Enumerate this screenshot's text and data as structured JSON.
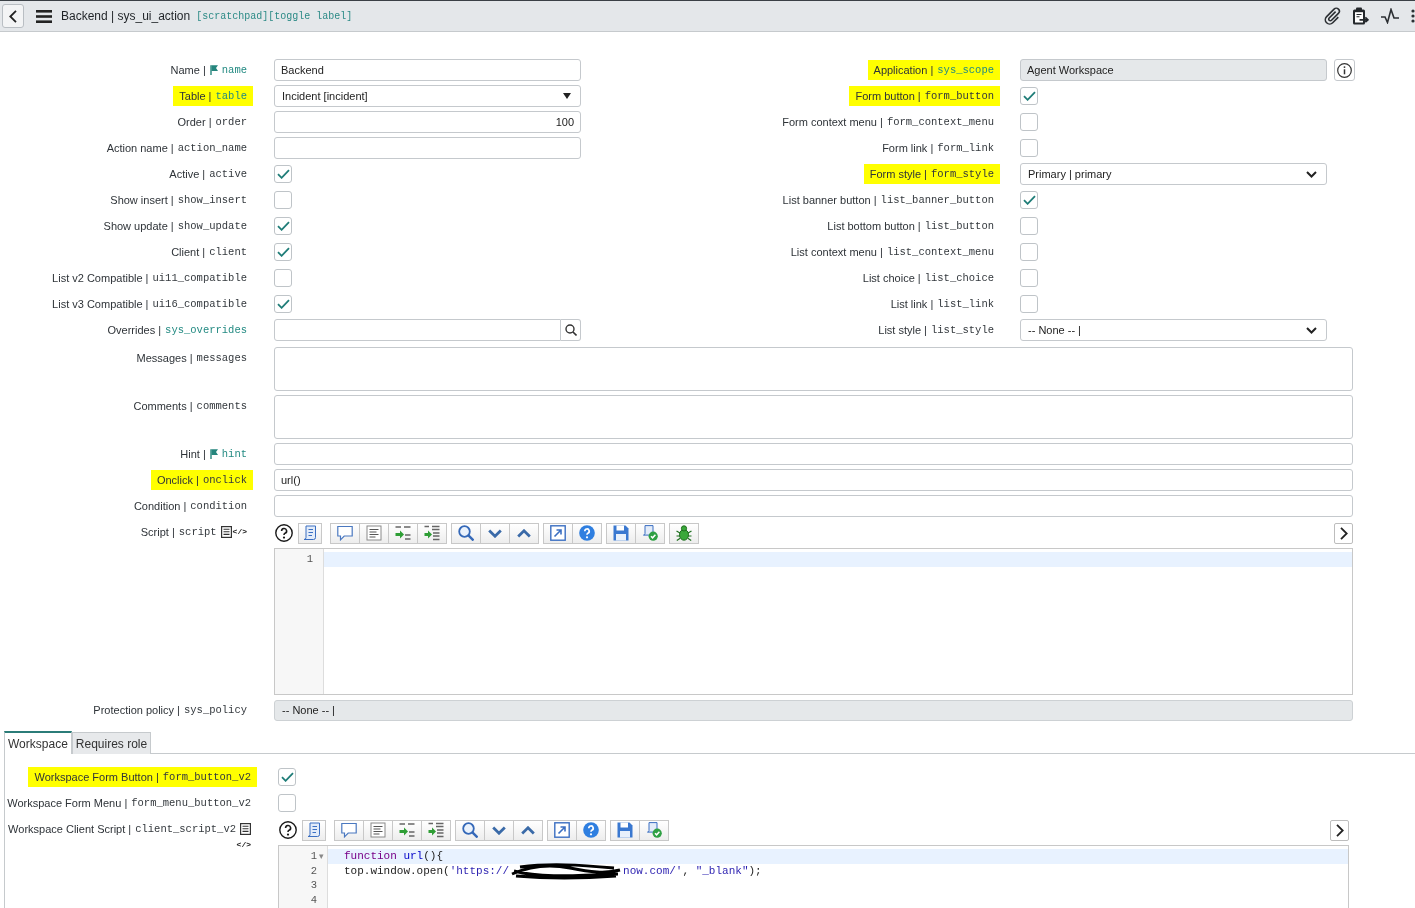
{
  "header": {
    "title": "Backend | sys_ui_action",
    "links": [
      "[scratchpad]",
      "[toggle label]"
    ]
  },
  "left_fields": [
    {
      "label": "Name |",
      "field": "name",
      "flag": true,
      "emphasized": true,
      "highlighted": false,
      "kind": "text",
      "value": "Backend"
    },
    {
      "label": "Table |",
      "field": "table",
      "flag": false,
      "emphasized": true,
      "highlighted": true,
      "kind": "choice",
      "value": "Incident [incident]"
    },
    {
      "label": "Order |",
      "field": "order",
      "flag": false,
      "emphasized": false,
      "highlighted": false,
      "kind": "number",
      "value": "100"
    },
    {
      "label": "Action name |",
      "field": "action_name",
      "flag": false,
      "emphasized": false,
      "highlighted": false,
      "kind": "text"
    },
    {
      "label": "Active |",
      "field": "active",
      "flag": false,
      "emphasized": false,
      "highlighted": false,
      "kind": "checkbox",
      "checked": true
    },
    {
      "label": "Show insert |",
      "field": "show_insert",
      "flag": false,
      "emphasized": false,
      "highlighted": false,
      "kind": "checkbox",
      "checked": false
    },
    {
      "label": "Show update |",
      "field": "show_update",
      "flag": false,
      "emphasized": false,
      "highlighted": false,
      "kind": "checkbox",
      "checked": true
    },
    {
      "label": "Client |",
      "field": "client",
      "flag": false,
      "emphasized": false,
      "highlighted": false,
      "kind": "checkbox",
      "checked": true
    },
    {
      "label": "List v2 Compatible |",
      "field": "ui11_compatible",
      "flag": false,
      "emphasized": false,
      "highlighted": false,
      "kind": "checkbox",
      "checked": false
    },
    {
      "label": "List v3 Compatible |",
      "field": "ui16_compatible",
      "flag": false,
      "emphasized": false,
      "highlighted": false,
      "kind": "checkbox",
      "checked": true
    },
    {
      "label": "Overrides |",
      "field": "sys_overrides",
      "flag": false,
      "emphasized": true,
      "highlighted": false,
      "kind": "reference"
    }
  ],
  "right_fields": [
    {
      "label": "Application |",
      "field": "sys_scope",
      "flag": false,
      "emphasized": true,
      "highlighted": true,
      "kind": "reference-readonly",
      "value": "Agent Workspace"
    },
    {
      "label": "Form button |",
      "field": "form_button",
      "flag": false,
      "emphasized": false,
      "highlighted": true,
      "kind": "checkbox",
      "checked": true
    },
    {
      "label": "Form context menu |",
      "field": "form_context_menu",
      "flag": false,
      "emphasized": false,
      "highlighted": false,
      "kind": "checkbox",
      "checked": false
    },
    {
      "label": "Form link |",
      "field": "form_link",
      "flag": false,
      "emphasized": false,
      "highlighted": false,
      "kind": "checkbox",
      "checked": false
    },
    {
      "label": "Form style |",
      "field": "form_style",
      "flag": false,
      "emphasized": false,
      "highlighted": true,
      "kind": "select",
      "value": "Primary | primary"
    },
    {
      "label": "List banner button |",
      "field": "list_banner_button",
      "flag": false,
      "emphasized": false,
      "highlighted": false,
      "kind": "checkbox",
      "checked": true
    },
    {
      "label": "List bottom button |",
      "field": "list_button",
      "flag": false,
      "emphasized": false,
      "highlighted": false,
      "kind": "checkbox",
      "checked": false
    },
    {
      "label": "List context menu |",
      "field": "list_context_menu",
      "flag": false,
      "emphasized": false,
      "highlighted": false,
      "kind": "checkbox",
      "checked": false
    },
    {
      "label": "List choice |",
      "field": "list_choice",
      "flag": false,
      "emphasized": false,
      "highlighted": false,
      "kind": "checkbox",
      "checked": false
    },
    {
      "label": "List link |",
      "field": "list_link",
      "flag": false,
      "emphasized": false,
      "highlighted": false,
      "kind": "checkbox",
      "checked": false
    },
    {
      "label": "List style |",
      "field": "list_style",
      "flag": false,
      "emphasized": false,
      "highlighted": false,
      "kind": "select",
      "value": "-- None -- |"
    }
  ],
  "wide_fields": [
    {
      "label": "Messages |",
      "field": "messages",
      "flag": false,
      "emphasized": false,
      "highlighted": false,
      "kind": "textarea"
    },
    {
      "label": "Comments |",
      "field": "comments",
      "flag": false,
      "emphasized": false,
      "highlighted": false,
      "kind": "textarea"
    },
    {
      "label": "Hint |",
      "field": "hint",
      "flag": true,
      "emphasized": true,
      "highlighted": false,
      "kind": "text"
    },
    {
      "label": "Onclick |",
      "field": "onclick",
      "flag": false,
      "emphasized": false,
      "highlighted": true,
      "kind": "text",
      "value": "url()"
    },
    {
      "label": "Condition |",
      "field": "condition",
      "flag": false,
      "emphasized": false,
      "highlighted": false,
      "kind": "text"
    },
    {
      "label": "Script |",
      "field": "script",
      "flag": false,
      "emphasized": false,
      "highlighted": false,
      "kind": "script",
      "code_toggle": "</>",
      "debug_button": true,
      "lines": [
        {
          "number": "1",
          "active": true
        }
      ]
    },
    {
      "label": "Protection policy |",
      "field": "sys_policy",
      "flag": false,
      "emphasized": false,
      "highlighted": false,
      "kind": "readonly",
      "value": "-- None -- |"
    }
  ],
  "tabs": [
    {
      "label": "Workspace",
      "selected": true
    },
    {
      "label": "Requires role",
      "selected": false
    }
  ],
  "workspace_fields": [
    {
      "label": "Workspace Form Button |",
      "field": "form_button_v2",
      "flag": false,
      "emphasized": false,
      "highlighted": true,
      "kind": "checkbox",
      "checked": true
    },
    {
      "label": "Workspace Form Menu |",
      "field": "form_menu_button_v2",
      "flag": false,
      "emphasized": false,
      "highlighted": false,
      "kind": "checkbox",
      "checked": false
    },
    {
      "label": "Workspace Client Script |",
      "field": "client_script_v2",
      "flag": false,
      "emphasized": false,
      "highlighted": false,
      "kind": "script",
      "code_toggle": "</>",
      "debug_button": false,
      "lines": [
        {
          "number": "1",
          "fold": "▾",
          "active": true,
          "segments": [
            {
              "text": "function",
              "kind": "keyword"
            },
            {
              "text": " url",
              "kind": "def"
            },
            {
              "text": "(){",
              "kind": "plain"
            }
          ]
        },
        {
          "number": "2",
          "active": false,
          "segments": [
            {
              "text": "top.window.open(",
              "kind": "plain"
            },
            {
              "text": "'https://",
              "kind": "string"
            },
            {
              "kind": "redaction"
            },
            {
              "text": "now.com/'",
              "kind": "string"
            },
            {
              "text": ", ",
              "kind": "plain"
            },
            {
              "text": "\"_blank\"",
              "kind": "string"
            },
            {
              "text": ");",
              "kind": "plain"
            }
          ]
        },
        {
          "number": "3",
          "active": false
        },
        {
          "number": "4",
          "active": false
        }
      ]
    }
  ]
}
